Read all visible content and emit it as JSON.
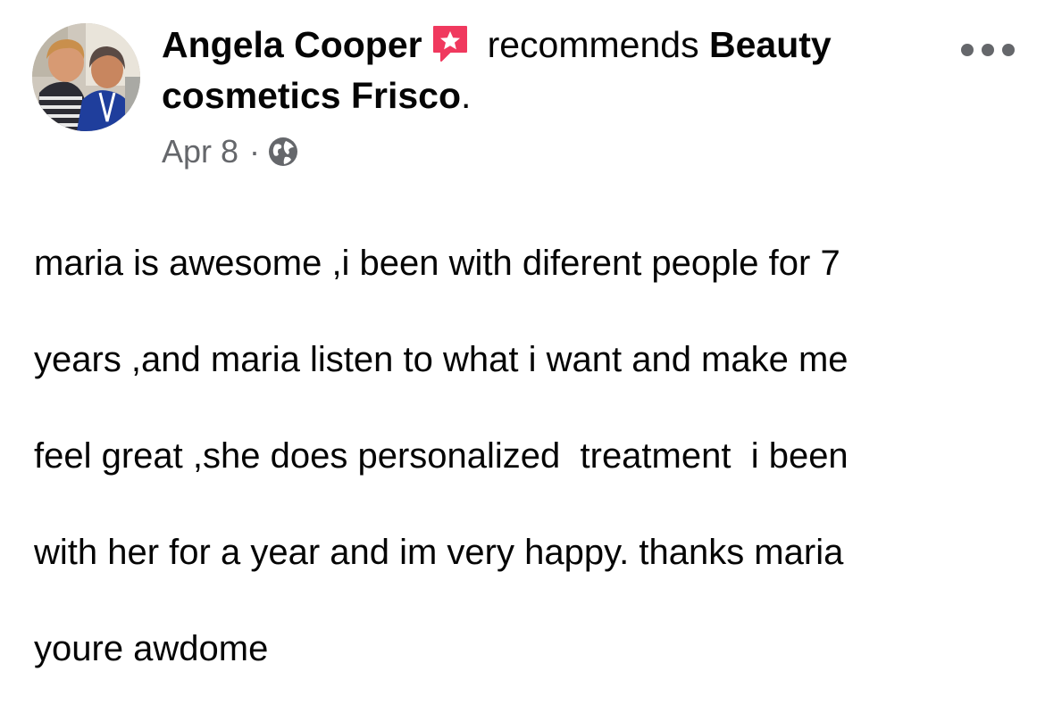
{
  "post": {
    "author": "Angela Cooper",
    "action": "recommends",
    "page_name": "Beauty cosmetics Frisco",
    "page_name_suffix": ".",
    "date": "Apr 8",
    "separator": "·",
    "audience_icon": "globe-icon",
    "badge_icon": "recommendation-star-icon",
    "menu_icon": "more-options-icon",
    "body_lines": [
      "maria is awesome ,i been with diferent people for 7",
      "years ,and maria listen to what i want and make me",
      "feel great ,she does personalized  treatment  i been",
      "with her for a year and im very happy. thanks maria",
      "youre awdome"
    ]
  },
  "colors": {
    "badge": "#f0395e",
    "meta_text": "#65676b",
    "primary_text": "#050505"
  }
}
